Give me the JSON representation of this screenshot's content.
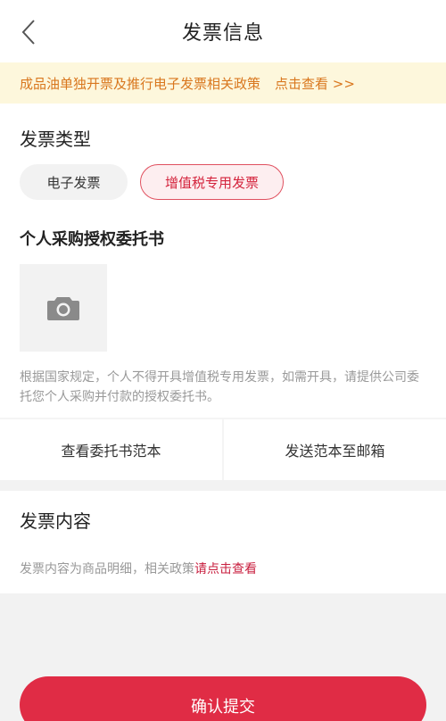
{
  "header": {
    "title": "发票信息",
    "back_icon": "chevron-left-icon"
  },
  "notice": {
    "text": "成品油单独开票及推行电子发票相关政策",
    "link_label": "点击查看 >>",
    "color": "#d9771e",
    "background": "#fdf7dc"
  },
  "invoice_type": {
    "title": "发票类型",
    "options": [
      {
        "label": "电子发票",
        "selected": false
      },
      {
        "label": "增值税专用发票",
        "selected": true
      }
    ]
  },
  "authorization": {
    "title": "个人采购授权委托书",
    "upload_icon": "camera-icon",
    "description": "根据国家规定，个人不得开具增值税专用发票，如需开具，请提供公司委托您个人采购并付款的授权委托书。",
    "view_sample_label": "查看委托书范本",
    "email_sample_label": "发送范本至邮箱"
  },
  "invoice_content": {
    "title": "发票内容",
    "description_prefix": "发票内容为商品明细，相关政策",
    "link_label": "请点击查看"
  },
  "submit": {
    "label": "确认提交",
    "color": "#e02c45"
  }
}
